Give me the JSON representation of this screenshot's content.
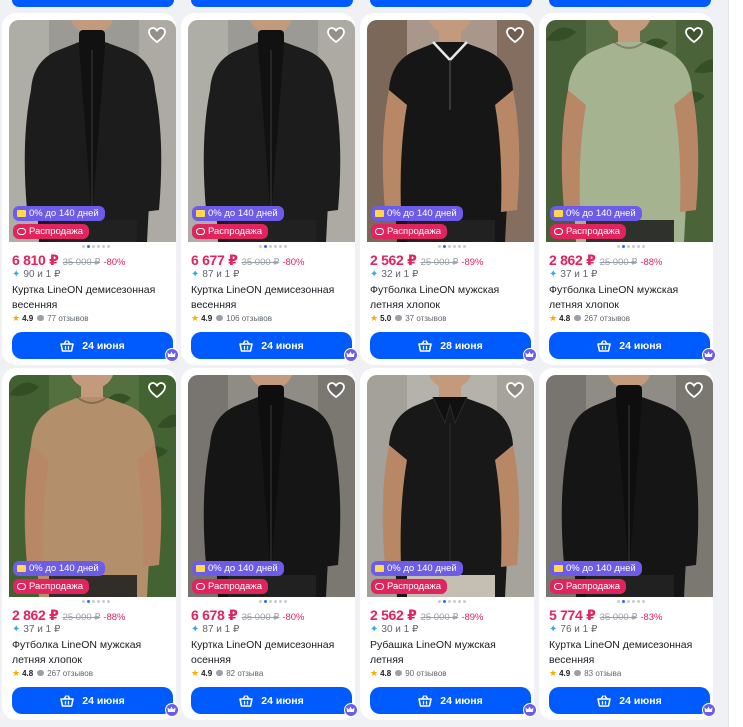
{
  "badges": {
    "credit": "0% до 140 дней",
    "sale": "Распродажа"
  },
  "products": [
    {
      "price": "6 810 ₽",
      "old_price": "35 000 ₽",
      "discount": "-80%",
      "points": "90 и 1 ₽",
      "title": "Куртка LineON демисезонная весенняя",
      "rating": "4.9",
      "reviews": "77 отзывов",
      "delivery": "24 июня",
      "image": "black-jacket"
    },
    {
      "price": "6 677 ₽",
      "old_price": "35 000 ₽",
      "discount": "-80%",
      "points": "87 и 1 ₽",
      "title": "Куртка LineON демисезонная весенняя",
      "rating": "4.9",
      "reviews": "106 отзывов",
      "delivery": "24 июня",
      "image": "black-jacket"
    },
    {
      "price": "2 562 ₽",
      "old_price": "25 000 ₽",
      "discount": "-89%",
      "points": "32 и 1 ₽",
      "title": "Футболка LineON мужская летняя хлопок",
      "rating": "5.0",
      "reviews": "37 отзывов",
      "delivery": "28 июня",
      "image": "black-polo"
    },
    {
      "price": "2 862 ₽",
      "old_price": "25 000 ₽",
      "discount": "-88%",
      "points": "37 и 1 ₽",
      "title": "Футболка LineON мужская летняя хлопок",
      "rating": "4.8",
      "reviews": "267 отзывов",
      "delivery": "24 июня",
      "image": "sage-tshirt"
    },
    {
      "price": "2 862 ₽",
      "old_price": "25 000 ₽",
      "discount": "-88%",
      "points": "37 и 1 ₽",
      "title": "Футболка LineON мужская летняя хлопок",
      "rating": "4.8",
      "reviews": "267 отзывов",
      "delivery": "24 июня",
      "image": "beige-tshirt"
    },
    {
      "price": "6 678 ₽",
      "old_price": "35 000 ₽",
      "discount": "-80%",
      "points": "87 и 1 ₽",
      "title": "Куртка LineON демисезонная осенняя",
      "rating": "4.9",
      "reviews": "82 отзыва",
      "delivery": "24 июня",
      "image": "leather-jacket"
    },
    {
      "price": "2 562 ₽",
      "old_price": "25 000 ₽",
      "discount": "-89%",
      "points": "30 и 1 ₽",
      "title": "Рубашка LineON мужская летняя",
      "rating": "4.8",
      "reviews": "90 отзывов",
      "delivery": "24 июня",
      "image": "black-shirt"
    },
    {
      "price": "5 774 ₽",
      "old_price": "35 000 ₽",
      "discount": "-83%",
      "points": "76 и 1 ₽",
      "title": "Куртка LineON демисезонная весенняя",
      "rating": "4.9",
      "reviews": "83 отзыва",
      "delivery": "24 июня",
      "image": "leather-jacket"
    }
  ],
  "colors": {
    "accent": "#005bff",
    "price": "#e0245e",
    "credit_badge": "#6c5ce7",
    "sale_badge": "#e0245e",
    "rating_star": "#ffa800"
  }
}
